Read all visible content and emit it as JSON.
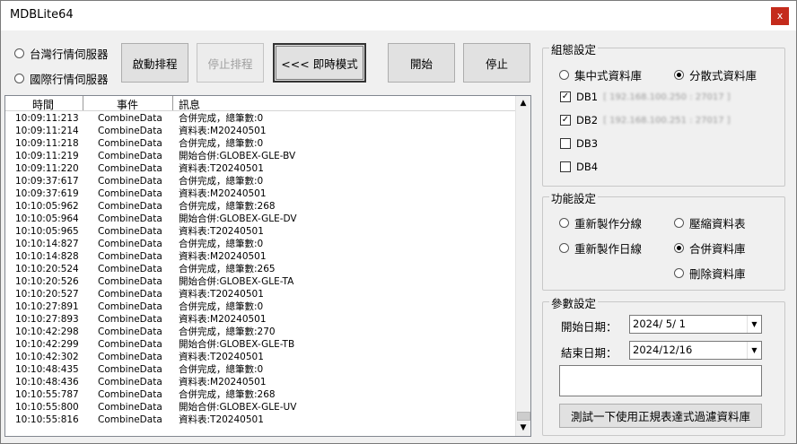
{
  "window": {
    "title": "MDBLite64",
    "close_glyph": "x"
  },
  "server_options": [
    {
      "label": "台灣行情伺服器",
      "selected": false
    },
    {
      "label": "國際行情伺服器",
      "selected": false
    }
  ],
  "toolbar": {
    "start_schedule": "啟動排程",
    "stop_schedule": "停止排程",
    "realtime_mode": "<<< 即時模式",
    "start": "開始",
    "stop": "停止"
  },
  "log": {
    "columns": [
      "時間",
      "事件",
      "訊息"
    ],
    "rows": [
      [
        "10:09:11:213",
        "CombineData",
        "合併完成，總筆數:0"
      ],
      [
        "10:09:11:214",
        "CombineData",
        "資料表:M20240501"
      ],
      [
        "10:09:11:218",
        "CombineData",
        "合併完成，總筆數:0"
      ],
      [
        "10:09:11:219",
        "CombineData",
        "開始合併:GLOBEX-GLE-BV"
      ],
      [
        "10:09:11:220",
        "CombineData",
        "資料表:T20240501"
      ],
      [
        "10:09:37:617",
        "CombineData",
        "合併完成，總筆數:0"
      ],
      [
        "10:09:37:619",
        "CombineData",
        "資料表:M20240501"
      ],
      [
        "10:10:05:962",
        "CombineData",
        "合併完成，總筆數:268"
      ],
      [
        "10:10:05:964",
        "CombineData",
        "開始合併:GLOBEX-GLE-DV"
      ],
      [
        "10:10:05:965",
        "CombineData",
        "資料表:T20240501"
      ],
      [
        "10:10:14:827",
        "CombineData",
        "合併完成，總筆數:0"
      ],
      [
        "10:10:14:828",
        "CombineData",
        "資料表:M20240501"
      ],
      [
        "10:10:20:524",
        "CombineData",
        "合併完成，總筆數:265"
      ],
      [
        "10:10:20:526",
        "CombineData",
        "開始合併:GLOBEX-GLE-TA"
      ],
      [
        "10:10:20:527",
        "CombineData",
        "資料表:T20240501"
      ],
      [
        "10:10:27:891",
        "CombineData",
        "合併完成，總筆數:0"
      ],
      [
        "10:10:27:893",
        "CombineData",
        "資料表:M20240501"
      ],
      [
        "10:10:42:298",
        "CombineData",
        "合併完成，總筆數:270"
      ],
      [
        "10:10:42:299",
        "CombineData",
        "開始合併:GLOBEX-GLE-TB"
      ],
      [
        "10:10:42:302",
        "CombineData",
        "資料表:T20240501"
      ],
      [
        "10:10:48:435",
        "CombineData",
        "合併完成，總筆數:0"
      ],
      [
        "10:10:48:436",
        "CombineData",
        "資料表:M20240501"
      ],
      [
        "10:10:55:787",
        "CombineData",
        "合併完成，總筆數:268"
      ],
      [
        "10:10:55:800",
        "CombineData",
        "開始合併:GLOBEX-GLE-UV"
      ],
      [
        "10:10:55:816",
        "CombineData",
        "資料表:T20240501"
      ]
    ]
  },
  "config": {
    "title": "組態設定",
    "mode_options": [
      {
        "label": "集中式資料庫",
        "selected": false
      },
      {
        "label": "分散式資料庫",
        "selected": true
      }
    ],
    "dbs": [
      {
        "label": "DB1",
        "checked": true,
        "addr": "[ 192.168.100.250 : 27017 ]"
      },
      {
        "label": "DB2",
        "checked": true,
        "addr": "[ 192.168.100.251 : 27017 ]"
      },
      {
        "label": "DB3",
        "checked": false,
        "addr": ""
      },
      {
        "label": "DB4",
        "checked": false,
        "addr": ""
      }
    ]
  },
  "functions": {
    "title": "功能設定",
    "options": [
      {
        "label": "重新製作分線",
        "selected": false
      },
      {
        "label": "壓縮資料表",
        "selected": false
      },
      {
        "label": "重新製作日線",
        "selected": false
      },
      {
        "label": "合併資料庫",
        "selected": true
      },
      {
        "label": "刪除資料庫",
        "selected": false
      }
    ]
  },
  "params": {
    "title": "參數設定",
    "start_label": "開始日期：",
    "start_value": "2024/ 5/ 1",
    "end_label": "結束日期：",
    "end_value": "2024/12/16",
    "text_value": "",
    "test_button": "測試一下使用正規表達式過濾資料庫"
  },
  "icons": {
    "scroll_up": "scroll-up-arrow",
    "scroll_down": "scroll-down-arrow",
    "dropdown": "chevron-down"
  }
}
